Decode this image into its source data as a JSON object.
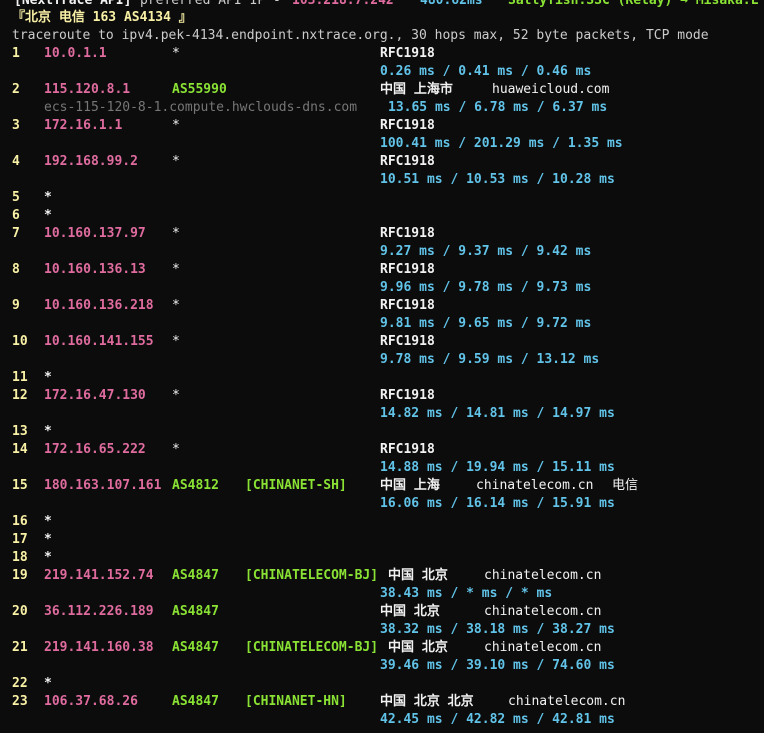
{
  "header": {
    "api_label": "[NextTrace API]",
    "preferred_ip_label": "preferred API IP -",
    "preferred_ip": "103.218.7.242",
    "latency": "480.62ms",
    "relay": "Sattyfish.SSC (Relay) → Misaka.L",
    "target": "『北京 电信 163 AS4134 』",
    "trace_info": "traceroute to ipv4.pek-4134.endpoint.nxtrace.org., 30 hops max, 52 byte packets, TCP mode"
  },
  "hops": [
    {
      "hop": "1",
      "ip": "10.0.1.1",
      "as": "*",
      "tag": "",
      "geo": "RFC1918",
      "host": "",
      "isp": "",
      "rtt": [
        "0.26 ms",
        "0.41 ms",
        "0.46 ms"
      ]
    },
    {
      "hop": "2",
      "ip": "115.120.8.1",
      "as": "AS55990",
      "tag": "",
      "geo": "中国 上海市",
      "host": "huaweicloud.com",
      "isp": "",
      "ptr": "ecs-115-120-8-1.compute.hwclouds-dns.com",
      "rtt": [
        "13.65 ms",
        "6.78 ms",
        "6.37 ms"
      ]
    },
    {
      "hop": "3",
      "ip": "172.16.1.1",
      "as": "*",
      "tag": "",
      "geo": "RFC1918",
      "host": "",
      "isp": "",
      "rtt": [
        "100.41 ms",
        "201.29 ms",
        "1.35 ms"
      ]
    },
    {
      "hop": "4",
      "ip": "192.168.99.2",
      "as": "*",
      "tag": "",
      "geo": "RFC1918",
      "host": "",
      "isp": "",
      "rtt": [
        "10.51 ms",
        "10.53 ms",
        "10.28 ms"
      ]
    },
    {
      "hop": "5",
      "ip": "*"
    },
    {
      "hop": "6",
      "ip": "*"
    },
    {
      "hop": "7",
      "ip": "10.160.137.97",
      "as": "*",
      "tag": "",
      "geo": "RFC1918",
      "host": "",
      "isp": "",
      "rtt": [
        "9.27 ms",
        "9.37 ms",
        "9.42 ms"
      ]
    },
    {
      "hop": "8",
      "ip": "10.160.136.13",
      "as": "*",
      "tag": "",
      "geo": "RFC1918",
      "host": "",
      "isp": "",
      "rtt": [
        "9.96 ms",
        "9.78 ms",
        "9.73 ms"
      ]
    },
    {
      "hop": "9",
      "ip": "10.160.136.218",
      "as": "*",
      "tag": "",
      "geo": "RFC1918",
      "host": "",
      "isp": "",
      "rtt": [
        "9.81 ms",
        "9.65 ms",
        "9.72 ms"
      ]
    },
    {
      "hop": "10",
      "ip": "10.160.141.155",
      "as": "*",
      "tag": "",
      "geo": "RFC1918",
      "host": "",
      "isp": "",
      "rtt": [
        "9.78 ms",
        "9.59 ms",
        "13.12 ms"
      ]
    },
    {
      "hop": "11",
      "ip": "*"
    },
    {
      "hop": "12",
      "ip": "172.16.47.130",
      "as": "*",
      "tag": "",
      "geo": "RFC1918",
      "host": "",
      "isp": "",
      "rtt": [
        "14.82 ms",
        "14.81 ms",
        "14.97 ms"
      ]
    },
    {
      "hop": "13",
      "ip": "*"
    },
    {
      "hop": "14",
      "ip": "172.16.65.222",
      "as": "*",
      "tag": "",
      "geo": "RFC1918",
      "host": "",
      "isp": "",
      "rtt": [
        "14.88 ms",
        "19.94 ms",
        "15.11 ms"
      ]
    },
    {
      "hop": "15",
      "ip": "180.163.107.161",
      "as": "AS4812",
      "tag": "[CHINANET-SH]",
      "geo": "中国 上海",
      "host": "chinatelecom.cn",
      "isp": "电信",
      "rtt": [
        "16.06 ms",
        "16.14 ms",
        "15.91 ms"
      ]
    },
    {
      "hop": "16",
      "ip": "*"
    },
    {
      "hop": "17",
      "ip": "*"
    },
    {
      "hop": "18",
      "ip": "*"
    },
    {
      "hop": "19",
      "ip": "219.141.152.74",
      "as": "AS4847",
      "tag": "[CHINATELECOM-BJ]",
      "geo": "中国 北京",
      "host": "chinatelecom.cn",
      "isp": "",
      "rtt": [
        "38.43 ms",
        "* ms",
        "* ms"
      ]
    },
    {
      "hop": "20",
      "ip": "36.112.226.189",
      "as": "AS4847",
      "tag": "",
      "geo": "中国 北京",
      "host": "chinatelecom.cn",
      "isp": "",
      "rtt": [
        "38.32 ms",
        "38.18 ms",
        "38.27 ms"
      ]
    },
    {
      "hop": "21",
      "ip": "219.141.160.38",
      "as": "AS4847",
      "tag": "[CHINATELECOM-BJ]",
      "geo": "中国 北京",
      "host": "chinatelecom.cn",
      "isp": "",
      "rtt": [
        "39.46 ms",
        "39.10 ms",
        "74.60 ms"
      ]
    },
    {
      "hop": "22",
      "ip": "*"
    },
    {
      "hop": "23",
      "ip": "106.37.68.26",
      "as": "AS4847",
      "tag": "[CHINANET-HN]",
      "geo": "中国 北京 北京",
      "host": "chinatelecom.cn",
      "isp": "",
      "rtt": [
        "42.45 ms",
        "42.82 ms",
        "42.81 ms"
      ]
    }
  ],
  "separator": " / "
}
